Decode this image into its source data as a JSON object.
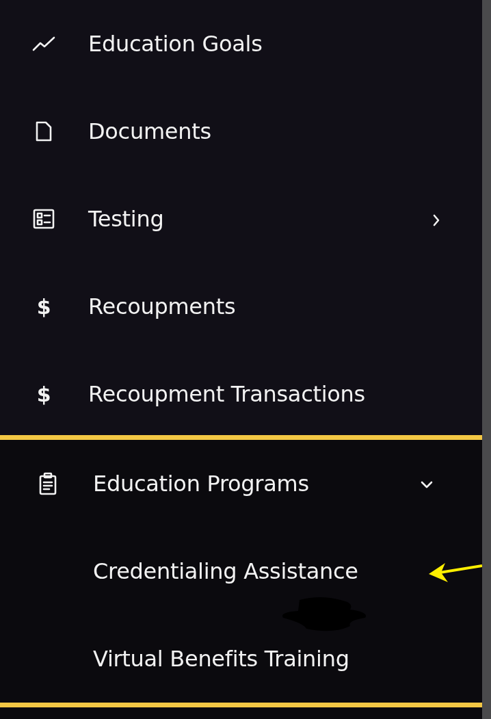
{
  "menu": {
    "items": [
      {
        "label": "Education Goals",
        "kind": "trend"
      },
      {
        "label": "Documents",
        "kind": "file"
      },
      {
        "label": "Testing",
        "kind": "form",
        "expanded": false
      },
      {
        "label": "Recoupments",
        "glyph": "$"
      },
      {
        "label": "Recoupment Transactions",
        "glyph": "$"
      }
    ]
  },
  "highlighted_group": {
    "label": "Education Programs",
    "kind": "clipboard",
    "expanded": true,
    "children": [
      {
        "label": "Credentialing Assistance",
        "pointed_at": true
      },
      {
        "label": "Virtual Benefits Training",
        "pointed_at": false
      }
    ]
  }
}
